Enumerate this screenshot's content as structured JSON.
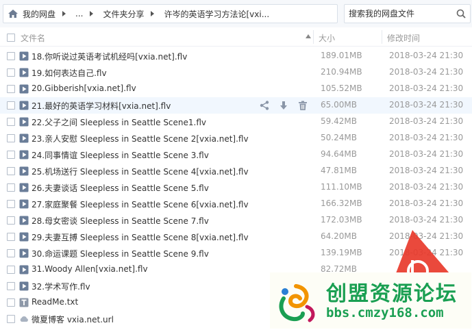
{
  "breadcrumb": {
    "items": [
      "我的网盘",
      "...",
      "文件夹分享",
      "许岑的英语学习方法论[vxi..."
    ]
  },
  "search": {
    "placeholder": "搜索我的网盘文件"
  },
  "columns": {
    "name": "文件名",
    "size": "大小",
    "modified": "修改时间"
  },
  "files": [
    {
      "name": "18.你听说过英语考试机经吗[vxia.net].flv",
      "size": "189.01MB",
      "date": "2018-03-24 21:30",
      "icon": "video-icon"
    },
    {
      "name": "19.如何表达自己.flv",
      "size": "210.94MB",
      "date": "2018-03-24 21:30",
      "icon": "video-icon"
    },
    {
      "name": "20.Gibberish[vxia.net].flv",
      "size": "105.52MB",
      "date": "2018-03-24 21:30",
      "icon": "video-icon"
    },
    {
      "name": "21.最好的英语学习材料[vxia.net].flv",
      "size": "65.00MB",
      "date": "2018-03-24 21:30",
      "icon": "video-icon"
    },
    {
      "name": "22.父子之间 Sleepless in Seattle Scene1.flv",
      "size": "59.42MB",
      "date": "2018-03-24 21:30",
      "icon": "video-icon"
    },
    {
      "name": "23.亲人安慰 Sleepless in Seattle Scene 2[vxia.net].flv",
      "size": "50.24MB",
      "date": "2018-03-24 21:30",
      "icon": "video-icon"
    },
    {
      "name": "24.同事情谊 Sleepless in Seattle Scene 3.flv",
      "size": "94.64MB",
      "date": "2018-03-24 21:30",
      "icon": "video-icon"
    },
    {
      "name": "25.机场送行 Sleepless in Seattle Scene 4[vxia.net].flv",
      "size": "47.81MB",
      "date": "2018-03-24 21:30",
      "icon": "video-icon"
    },
    {
      "name": "26.夫妻谈话 Sleepless in Seattle Scene 5.flv",
      "size": "111.10MB",
      "date": "2018-03-24 21:30",
      "icon": "video-icon"
    },
    {
      "name": "27.家庭聚餐 Sleepless in Seattle Scene 6[vxia.net].flv",
      "size": "166.32MB",
      "date": "2018-03-24 21:30",
      "icon": "video-icon"
    },
    {
      "name": "28.母女密谈 Sleepless in Seattle Scene 7.flv",
      "size": "172.03MB",
      "date": "2018-03-24 21:30",
      "icon": "video-icon"
    },
    {
      "name": "29.夫妻互搏 Sleepless in Seattle Scene 8[vxia.net].flv",
      "size": "64.20MB",
      "date": "2018-03-24 21:30",
      "icon": "video-icon"
    },
    {
      "name": "30.命运课题 Sleepless in Seattle Scene 9.flv",
      "size": "139.19MB",
      "date": "2018-03-24 21:30",
      "icon": "video-icon"
    },
    {
      "name": "31.Woody Allen[vxia.net].flv",
      "size": "82.72MB",
      "date": "",
      "icon": "video-icon"
    },
    {
      "name": "32.学术写作.flv",
      "size": "",
      "date": "",
      "icon": "video-icon"
    },
    {
      "name": "ReadMe.txt",
      "size": "",
      "date": "",
      "icon": "text-file-icon"
    },
    {
      "name": "微夏博客 vxia.net.url",
      "size": "",
      "date": "",
      "icon": "cloud-link-icon"
    }
  ],
  "hovered_row": 3,
  "watermark": {
    "title": "创盟资源论坛",
    "url": "bbs.cmzy168.com"
  },
  "colors": {
    "video_icon": "#6a7d98",
    "row_hover": "#f1f7fe",
    "watermark_green": "#1a9f52",
    "badge_red": "#e8392b"
  }
}
